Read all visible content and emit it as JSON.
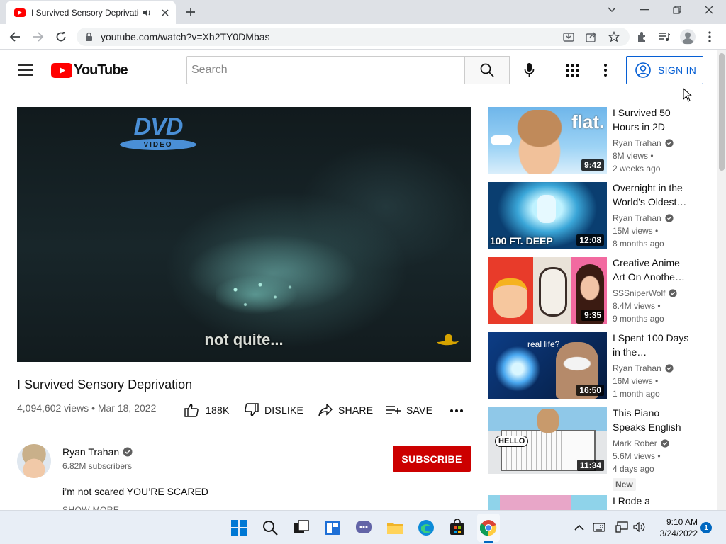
{
  "browser": {
    "tab_title": "I Survived Sensory Deprivation - YouTube",
    "url": "youtube.com/watch?v=Xh2TY0DMbas"
  },
  "header": {
    "logo_text": "YouTube",
    "search_placeholder": "Search",
    "signin_label": "SIGN IN"
  },
  "player": {
    "overlay_logo_top": "DVD",
    "overlay_logo_bottom": "VIDEO",
    "subtitle": "not quite..."
  },
  "video": {
    "title": "I Survived Sensory Deprivation",
    "meta": "4,094,602 views • Mar 18, 2022",
    "likes": "188K",
    "dislike_label": "DISLIKE",
    "share_label": "SHARE",
    "save_label": "SAVE"
  },
  "channel": {
    "name": "Ryan Trahan",
    "subscribers": "6.82M subscribers",
    "subscribe_label": "SUBSCRIBE",
    "description": "i’m not scared YOU’RE SCARED",
    "show_more": "SHOW MORE"
  },
  "recommendations": [
    {
      "title": "I Survived 50 Hours in 2D",
      "channel": "Ryan Trahan",
      "views": "8M views •",
      "age": "2 weeks ago",
      "duration": "9:42",
      "thumb_text": "flat."
    },
    {
      "title": "Overnight in the World's Oldest…",
      "channel": "Ryan Trahan",
      "views": "15M views •",
      "age": "8 months ago",
      "duration": "12:08",
      "thumb_text": "100 FT. DEEP"
    },
    {
      "title": "Creative Anime Art On Anothe…",
      "channel": "SSSniperWolf",
      "views": "8.4M views •",
      "age": "9 months ago",
      "duration": "9:35",
      "thumb_text": ""
    },
    {
      "title": "I Spent 100 Days in the…",
      "channel": "Ryan Trahan",
      "views": "16M views •",
      "age": "1 month ago",
      "duration": "16:50",
      "thumb_text": "real life?"
    },
    {
      "title": "This Piano Speaks English",
      "channel": "Mark Rober",
      "views": "5.6M views •",
      "age": "4 days ago",
      "duration": "11:34",
      "thumb_text": "HELLO",
      "badge": "New"
    },
    {
      "title": "I Rode a",
      "channel": "",
      "views": "",
      "age": "",
      "duration": "",
      "thumb_text": ""
    }
  ],
  "taskbar": {
    "time": "9:10 AM",
    "date": "3/24/2022",
    "notifications": "1"
  },
  "colors": {
    "youtube_red": "#ff0000",
    "subscribe_red": "#cc0000",
    "link_blue": "#065fd4"
  }
}
